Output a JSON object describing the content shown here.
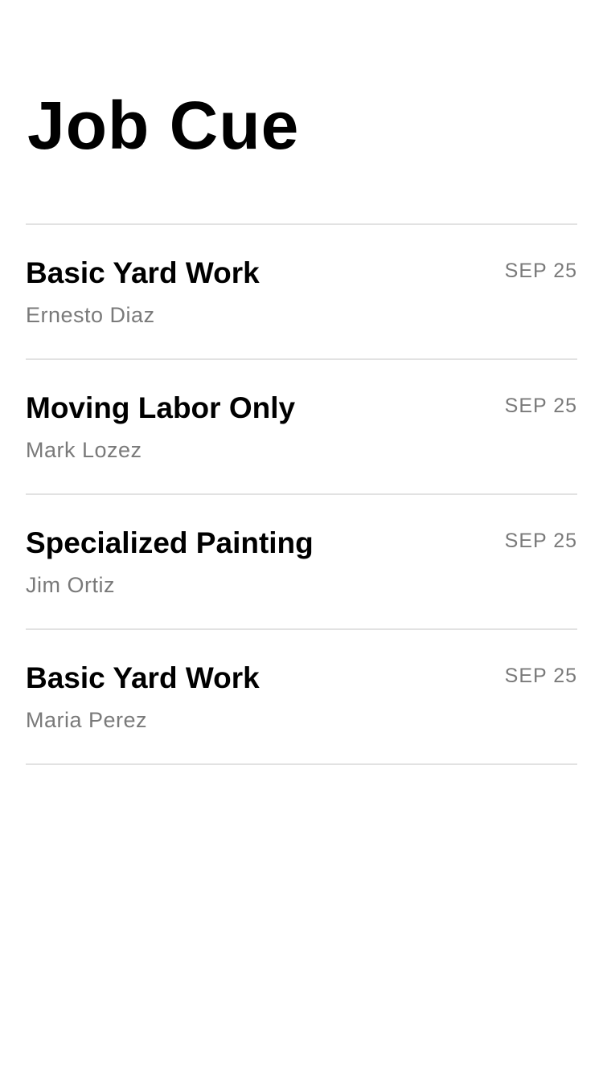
{
  "header": {
    "title": "Job Cue"
  },
  "jobs": [
    {
      "title": "Basic Yard Work",
      "person": "Ernesto Diaz",
      "date": "SEP 25"
    },
    {
      "title": "Moving Labor Only",
      "person": "Mark Lozez",
      "date": "SEP 25"
    },
    {
      "title": "Specialized Painting",
      "person": "Jim Ortiz",
      "date": "SEP 25"
    },
    {
      "title": "Basic Yard Work",
      "person": "Maria Perez",
      "date": "SEP 25"
    }
  ],
  "colors": {
    "background": "#ffffff",
    "primary_text": "#000000",
    "secondary_text": "#7a7a7a",
    "divider": "#e2e2e2"
  }
}
